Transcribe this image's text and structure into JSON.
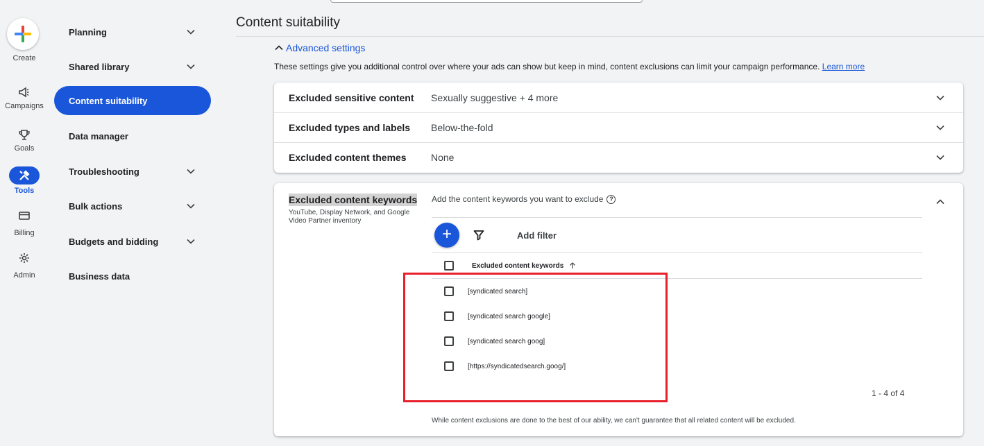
{
  "rail": {
    "create_label": "Create",
    "items": [
      {
        "label": "Campaigns",
        "icon": "megaphone-icon"
      },
      {
        "label": "Goals",
        "icon": "trophy-icon"
      },
      {
        "label": "Tools",
        "icon": "tools-icon",
        "active": true
      },
      {
        "label": "Billing",
        "icon": "credit-card-icon"
      },
      {
        "label": "Admin",
        "icon": "gear-icon"
      }
    ]
  },
  "submenu": {
    "items": [
      {
        "label": "Planning",
        "expandable": true
      },
      {
        "label": "Shared library",
        "expandable": true
      },
      {
        "label": "Content suitability",
        "active": true
      },
      {
        "label": "Data manager"
      },
      {
        "label": "Troubleshooting",
        "expandable": true
      },
      {
        "label": "Bulk actions",
        "expandable": true
      },
      {
        "label": "Budgets and bidding",
        "expandable": true
      },
      {
        "label": "Business data"
      }
    ]
  },
  "main": {
    "title": "Content suitability",
    "advanced_toggle": "Advanced settings",
    "description": "These settings give you additional control over where your ads can show but keep in mind, content exclusions can limit your campaign performance.",
    "learn_more": "Learn more",
    "settings": [
      {
        "title": "Excluded sensitive content",
        "value": "Sexually suggestive + 4 more"
      },
      {
        "title": "Excluded types and labels",
        "value": "Below-the-fold"
      },
      {
        "title": "Excluded content themes",
        "value": "None"
      }
    ],
    "keywords_panel": {
      "title": "Excluded content keywords",
      "subtitle": "YouTube, Display Network, and Google Video Partner inventory",
      "prompt": "Add the content keywords you want to exclude",
      "add_filter": "Add filter",
      "column_header": "Excluded content keywords",
      "sort_icon": "arrow-up-icon",
      "keywords": [
        "[syndicated search]",
        "[syndicated search google]",
        "[syndicated search goog]",
        "[https://syndicatedsearch.goog/]"
      ],
      "pagination": "1 - 4 of 4",
      "note": "While content exclusions are done to the best of our ability, we can't guarantee that all related content will be excluded."
    }
  },
  "colors": {
    "accent": "#1a56d9",
    "highlight": "#e8202a"
  }
}
